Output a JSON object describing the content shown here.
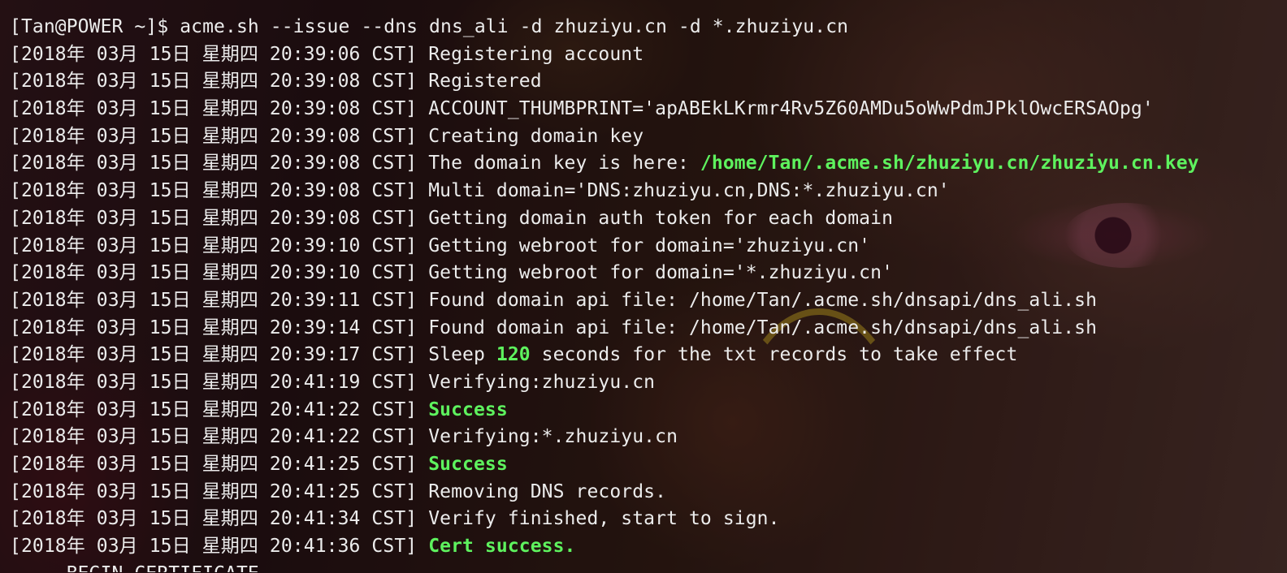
{
  "terminal": {
    "prompt_line": "[Tan@POWER ~]$ acme.sh --issue --dns dns_ali -d zhuziyu.cn -d *.zhuziyu.cn",
    "log": [
      {
        "ts": "[2018年 03月 15日 星期四 20:39:06 CST]",
        "msg": "Registering account"
      },
      {
        "ts": "[2018年 03月 15日 星期四 20:39:08 CST]",
        "msg": "Registered"
      },
      {
        "ts": "[2018年 03月 15日 星期四 20:39:08 CST]",
        "msg": "ACCOUNT_THUMBPRINT='apABEkLKrmr4Rv5Z60AMDu5oWwPdmJPklOwcERSAOpg'"
      },
      {
        "ts": "[2018年 03月 15日 星期四 20:39:08 CST]",
        "msg": "Creating domain key"
      },
      {
        "ts": "[2018年 03月 15日 星期四 20:39:08 CST]",
        "msg": "The domain key is here: ",
        "hl": "/home/Tan/.acme.sh/zhuziyu.cn/zhuziyu.cn.key"
      },
      {
        "ts": "[2018年 03月 15日 星期四 20:39:08 CST]",
        "msg": "Multi domain='DNS:zhuziyu.cn,DNS:*.zhuziyu.cn'"
      },
      {
        "ts": "[2018年 03月 15日 星期四 20:39:08 CST]",
        "msg": "Getting domain auth token for each domain"
      },
      {
        "ts": "[2018年 03月 15日 星期四 20:39:10 CST]",
        "msg": "Getting webroot for domain='zhuziyu.cn'"
      },
      {
        "ts": "[2018年 03月 15日 星期四 20:39:10 CST]",
        "msg": "Getting webroot for domain='*.zhuziyu.cn'"
      },
      {
        "ts": "[2018年 03月 15日 星期四 20:39:11 CST]",
        "msg": "Found domain api file: /home/Tan/.acme.sh/dnsapi/dns_ali.sh"
      },
      {
        "ts": "[2018年 03月 15日 星期四 20:39:14 CST]",
        "msg": "Found domain api file: /home/Tan/.acme.sh/dnsapi/dns_ali.sh"
      },
      {
        "ts": "[2018年 03月 15日 星期四 20:39:17 CST]",
        "msg": "Sleep ",
        "hl": "120",
        "msg_after": " seconds for the txt records to take effect"
      },
      {
        "ts": "[2018年 03月 15日 星期四 20:41:19 CST]",
        "msg": "Verifying:zhuziyu.cn"
      },
      {
        "ts": "[2018年 03月 15日 星期四 20:41:22 CST]",
        "msg": "",
        "hl": "Success"
      },
      {
        "ts": "[2018年 03月 15日 星期四 20:41:22 CST]",
        "msg": "Verifying:*.zhuziyu.cn"
      },
      {
        "ts": "[2018年 03月 15日 星期四 20:41:25 CST]",
        "msg": "",
        "hl": "Success"
      },
      {
        "ts": "[2018年 03月 15日 星期四 20:41:25 CST]",
        "msg": "Removing DNS records."
      },
      {
        "ts": "[2018年 03月 15日 星期四 20:41:34 CST]",
        "msg": "Verify finished, start to sign."
      },
      {
        "ts": "[2018年 03月 15日 星期四 20:41:36 CST]",
        "msg": "",
        "hl": "Cert success."
      }
    ],
    "partial_line": "-----BEGIN CERTIFICATE-----",
    "colors": {
      "text": "#ececec",
      "highlight": "#5ef25e"
    }
  }
}
